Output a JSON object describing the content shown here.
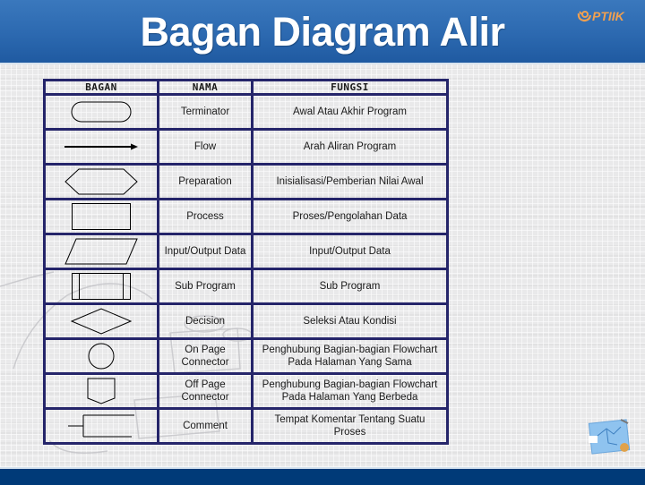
{
  "slide": {
    "title": "Bagan Diagram Alir",
    "logo_text": "PTIIK",
    "colors": {
      "header_blue": "#2c69b0",
      "footer_blue": "#003a78",
      "table_border": "#25256a",
      "logo_orange": "#f0a050"
    }
  },
  "table": {
    "headers": [
      "BAGAN",
      "NAMA",
      "FUNGSI"
    ],
    "rows": [
      {
        "symbol": "terminator-symbol",
        "nama": "Terminator",
        "fungsi": "Awal Atau Akhir Program"
      },
      {
        "symbol": "flow-arrow-symbol",
        "nama": "Flow",
        "fungsi": "Arah Aliran Program"
      },
      {
        "symbol": "preparation-hexagon-symbol",
        "nama": "Preparation",
        "fungsi": "Inisialisasi/Pemberian Nilai Awal"
      },
      {
        "symbol": "process-rectangle-symbol",
        "nama": "Process",
        "fungsi": "Proses/Pengolahan Data"
      },
      {
        "symbol": "input-output-parallelogram-symbol",
        "nama": "Input/Output Data",
        "fungsi": "Input/Output Data"
      },
      {
        "symbol": "sub-program-symbol",
        "nama": "Sub Program",
        "fungsi": "Sub Program"
      },
      {
        "symbol": "decision-diamond-symbol",
        "nama": "Decision",
        "fungsi": "Seleksi Atau Kondisi"
      },
      {
        "symbol": "on-page-connector-circle-symbol",
        "nama_line1": "On Page",
        "nama_line2": "Connector",
        "fungsi_line1": "Penghubung Bagian-bagian Flowchart",
        "fungsi_line2": "Pada Halaman Yang Sama"
      },
      {
        "symbol": "off-page-connector-symbol",
        "nama_line1": "Off Page",
        "nama_line2": "Connector",
        "fungsi_line1": "Penghubung Bagian-bagian Flowchart",
        "fungsi_line2": "Pada Halaman Yang Berbeda"
      },
      {
        "symbol": "comment-bracket-symbol",
        "nama": "Comment",
        "fungsi_line1": "Tempat Komentar Tentang Suatu",
        "fungsi_line2": "Proses"
      }
    ]
  }
}
